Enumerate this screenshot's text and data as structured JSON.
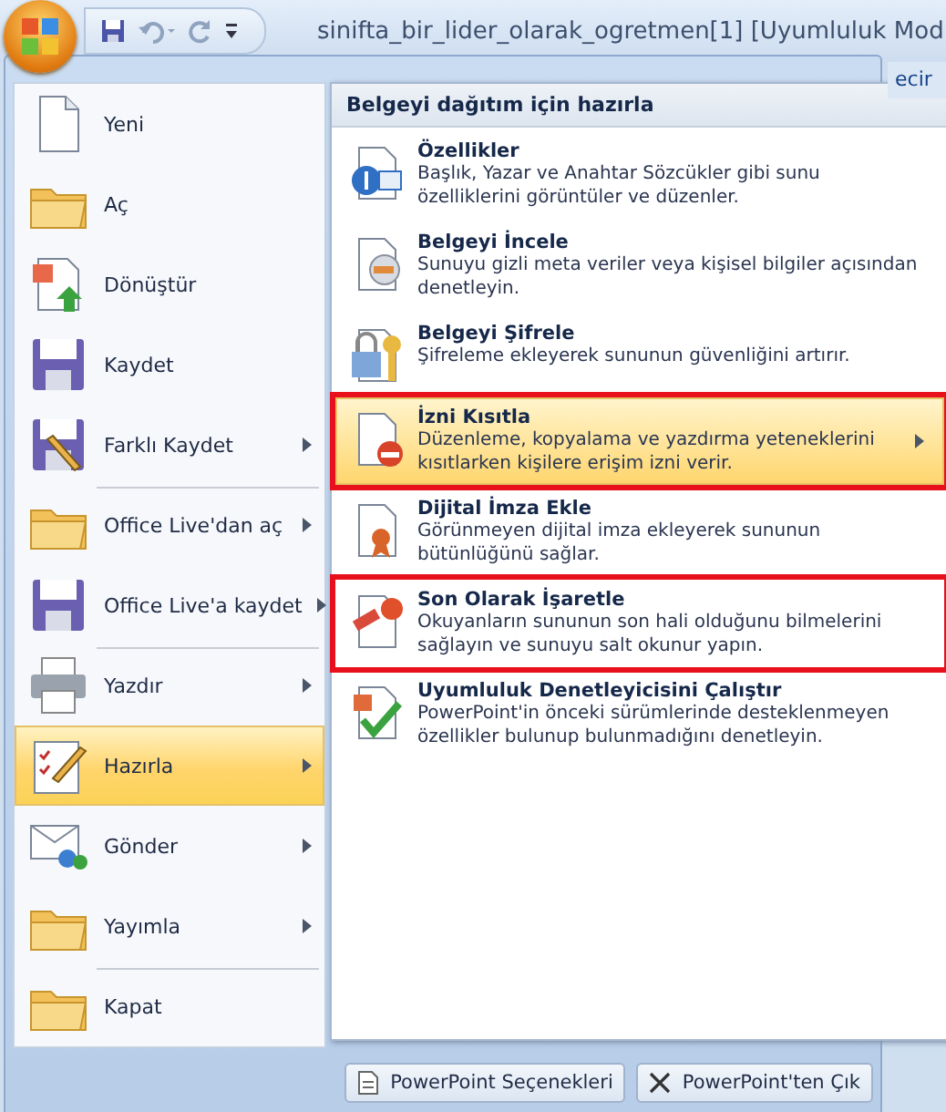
{
  "window": {
    "title": "sinifta_bir_lider_olarak_ogretmen[1] [Uyumluluk Mod"
  },
  "ribbon_tab_fragment": "ecir",
  "menu": [
    {
      "label": "Yeni",
      "submenu": false,
      "selected": false,
      "separator_before": false
    },
    {
      "label": "Aç",
      "submenu": false,
      "selected": false,
      "separator_before": false
    },
    {
      "label": "Dönüştür",
      "submenu": false,
      "selected": false,
      "separator_before": false
    },
    {
      "label": "Kaydet",
      "submenu": false,
      "selected": false,
      "separator_before": false
    },
    {
      "label": "Farklı Kaydet",
      "submenu": true,
      "selected": false,
      "separator_before": false
    },
    {
      "label": "Office Live'dan aç",
      "submenu": true,
      "selected": false,
      "separator_before": true
    },
    {
      "label": "Office Live'a kaydet",
      "submenu": true,
      "selected": false,
      "separator_before": false
    },
    {
      "label": "Yazdır",
      "submenu": true,
      "selected": false,
      "separator_before": true
    },
    {
      "label": "Hazırla",
      "submenu": true,
      "selected": true,
      "separator_before": false
    },
    {
      "label": "Gönder",
      "submenu": true,
      "selected": false,
      "separator_before": false
    },
    {
      "label": "Yayımla",
      "submenu": true,
      "selected": false,
      "separator_before": false
    },
    {
      "label": "Kapat",
      "submenu": false,
      "selected": false,
      "separator_before": true
    }
  ],
  "submenu": {
    "title": "Belgeyi dağıtım için hazırla",
    "items": [
      {
        "title": "Özellikler",
        "description": "Başlık, Yazar ve Anahtar Sözcükler gibi sunu özelliklerini görüntüler ve düzenler.",
        "submenu": false,
        "selected": false,
        "highlighted": false
      },
      {
        "title": "Belgeyi İncele",
        "description": "Sunuyu gizli meta veriler veya kişisel bilgiler açısından denetleyin.",
        "submenu": false,
        "selected": false,
        "highlighted": false
      },
      {
        "title": "Belgeyi Şifrele",
        "description": "Şifreleme ekleyerek sununun güvenliğini artırır.",
        "submenu": false,
        "selected": false,
        "highlighted": false
      },
      {
        "title": "İzni Kısıtla",
        "description": "Düzenleme, kopyalama ve yazdırma yeteneklerini kısıtlarken kişilere erişim izni verir.",
        "submenu": true,
        "selected": true,
        "highlighted": true
      },
      {
        "title": "Dijital İmza Ekle",
        "description": "Görünmeyen dijital imza ekleyerek sununun bütünlüğünü sağlar.",
        "submenu": false,
        "selected": false,
        "highlighted": false
      },
      {
        "title": "Son Olarak İşaretle",
        "description": "Okuyanların sununun son hali olduğunu bilmelerini sağlayın ve sunuyu salt okunur yapın.",
        "submenu": false,
        "selected": false,
        "highlighted": true
      },
      {
        "title": "Uyumluluk Denetleyicisini Çalıştır",
        "description": "PowerPoint'in önceki sürümlerinde desteklenmeyen özellikler bulunup bulunmadığını denetleyin.",
        "submenu": false,
        "selected": false,
        "highlighted": false
      }
    ]
  },
  "buttons": [
    {
      "label": "PowerPoint Seçenekleri"
    },
    {
      "label": "PowerPoint'ten Çık"
    }
  ]
}
